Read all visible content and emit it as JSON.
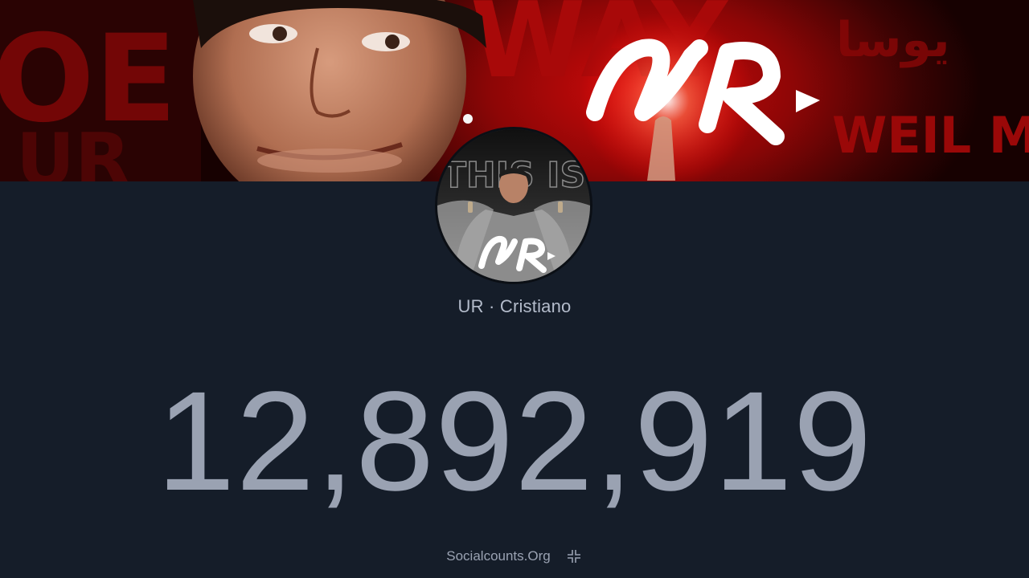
{
  "channel": {
    "name": "UR · Cristiano",
    "subscriber_count": "12,892,919"
  },
  "banner": {
    "logo_text": "UR",
    "background_words": [
      "WAY",
      "WEIL M"
    ]
  },
  "avatar": {
    "overlay_text": "THIS IS",
    "logo_text": "UR"
  },
  "footer": {
    "site_label": "Socialcounts.Org",
    "collapse_icon": "collapse-arrows-icon"
  },
  "colors": {
    "page_background": "#151d29",
    "counter_text": "#9aa2b2",
    "banner_red": "#c40808"
  }
}
